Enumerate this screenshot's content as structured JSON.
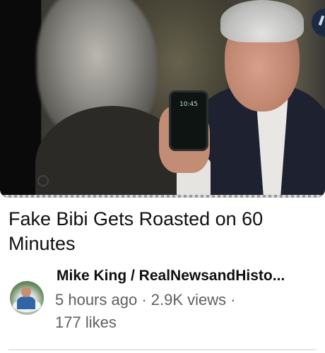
{
  "video": {
    "phone_time": "10:45",
    "title": "Fake Bibi Gets Roasted on 60 Minutes",
    "channel": "Mike King / RealNewsandHisto...",
    "uploaded": "5 hours ago",
    "views": "2.9K views",
    "likes": "177 likes",
    "separator": " · "
  }
}
